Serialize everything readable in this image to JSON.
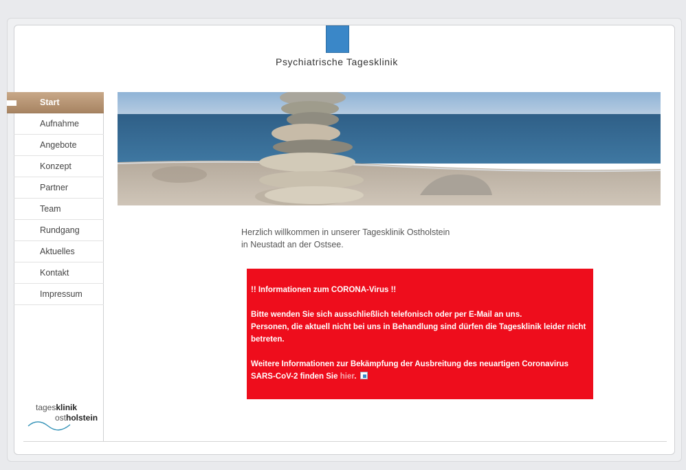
{
  "header": {
    "title": "Psychiatrische Tagesklinik"
  },
  "nav": {
    "items": [
      {
        "label": "Start",
        "active": true
      },
      {
        "label": "Aufnahme"
      },
      {
        "label": "Angebote"
      },
      {
        "label": "Konzept"
      },
      {
        "label": "Partner"
      },
      {
        "label": "Team"
      },
      {
        "label": "Rundgang"
      },
      {
        "label": "Aktuelles"
      },
      {
        "label": "Kontakt"
      },
      {
        "label": "Impressum"
      }
    ]
  },
  "brand": {
    "line1_light": "tages",
    "line1_bold": "klinik",
    "line2_light": "ost",
    "line2_bold": "holstein"
  },
  "welcome": {
    "line1": "Herzlich willkommen in unserer Tagesklinik Ostholstein",
    "line2": "in Neustadt an der Ostsee."
  },
  "notice": {
    "title": "!! Informationen zum CORONA-Virus !!",
    "p1": "Bitte wenden Sie sich ausschließlich telefonisch oder per E-Mail an uns.",
    "p2": "Personen, die aktuell nicht bei uns in Behandlung sind dürfen die Tagesklinik leider nicht betreten.",
    "p3_prefix": "Weitere Informationen zur Bekämpfung der Ausbreitung des neuartigen Coronavirus SARS-CoV-2 finden Sie ",
    "link": "hier",
    "p3_suffix": ".",
    "background_color": "#ee0d1c"
  },
  "colors": {
    "accent_blue": "#3a87c8",
    "nav_active": "#b08d6a"
  }
}
